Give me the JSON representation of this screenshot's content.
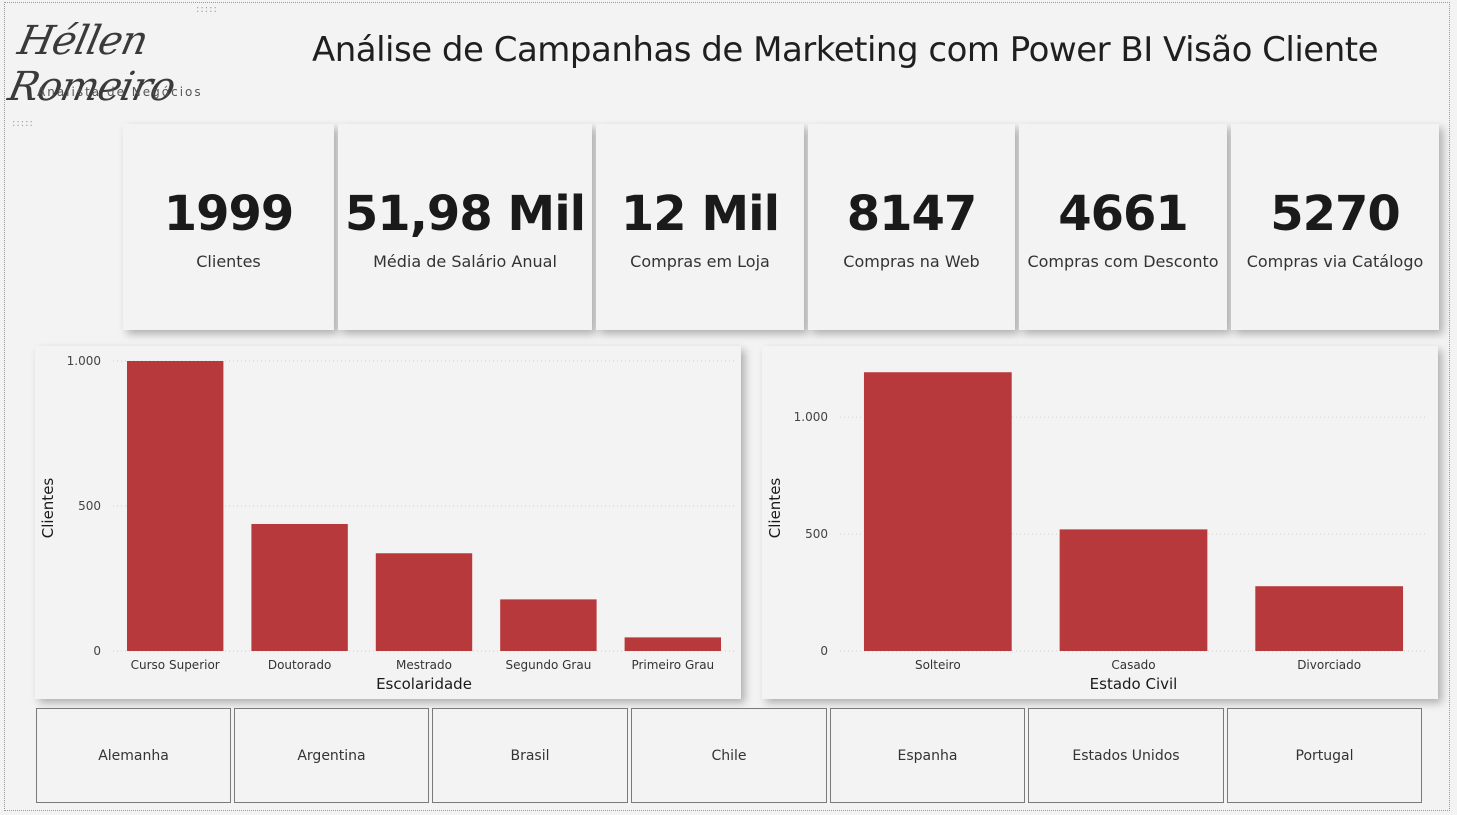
{
  "logo": {
    "name": "Héllen Romeiro",
    "subtitle": "Analista de Negócios"
  },
  "title": "Análise de Campanhas de Marketing com Power BI Visão Cliente",
  "kpis": [
    {
      "value": "1999",
      "label": "Clientes"
    },
    {
      "value": "51,98 Mil",
      "label": "Média de Salário Anual"
    },
    {
      "value": "12 Mil",
      "label": "Compras em Loja"
    },
    {
      "value": "8147",
      "label": "Compras na Web"
    },
    {
      "value": "4661",
      "label": "Compras com Desconto"
    },
    {
      "value": "5270",
      "label": "Compras via Catálogo"
    }
  ],
  "colors": {
    "bar": "#b8393b",
    "grid": "#cfcfcf"
  },
  "chart_data": [
    {
      "type": "bar",
      "categories": [
        "Curso Superior",
        "Doutorado",
        "Mestrado",
        "Segundo Grau",
        "Primeiro Grau"
      ],
      "values": [
        1000,
        438,
        337,
        178,
        47
      ],
      "xlabel": "Escolaridade",
      "ylabel": "Clientes",
      "ylim": [
        0,
        1000
      ],
      "yticks": [
        0,
        500,
        1000
      ],
      "ytick_labels": [
        "0",
        "500",
        "1.000"
      ],
      "grid": true
    },
    {
      "type": "bar",
      "categories": [
        "Solteiro",
        "Casado",
        "Divorciado"
      ],
      "values": [
        1192,
        520,
        277
      ],
      "xlabel": "Estado Civil",
      "ylabel": "Clientes",
      "ylim": [
        0,
        1240
      ],
      "yticks": [
        0,
        500,
        1000
      ],
      "ytick_labels": [
        "0",
        "500",
        "1.000"
      ],
      "grid": true
    }
  ],
  "slicer": {
    "countries": [
      "Alemanha",
      "Argentina",
      "Brasil",
      "Chile",
      "Espanha",
      "Estados Unidos",
      "Portugal"
    ]
  }
}
